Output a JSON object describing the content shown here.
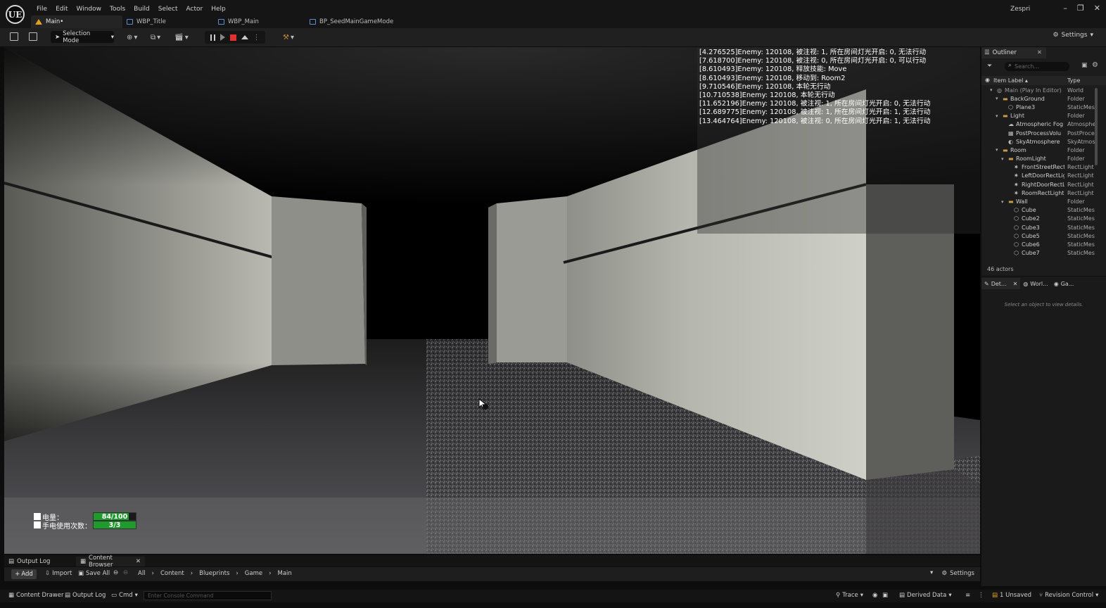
{
  "app": {
    "logo": "UE",
    "user": "Zespri",
    "menu": [
      "File",
      "Edit",
      "Window",
      "Tools",
      "Build",
      "Select",
      "Actor",
      "Help"
    ],
    "tabs": [
      {
        "label": "Main•",
        "active": true,
        "icon": "level-icon"
      },
      {
        "label": "WBP_Title",
        "active": false,
        "icon": "widget-blueprint-icon"
      },
      {
        "label": "WBP_Main",
        "active": false,
        "icon": "widget-blueprint-icon"
      },
      {
        "label": "BP_SeedMainGameMode",
        "active": false,
        "icon": "blueprint-icon"
      }
    ],
    "window_controls": [
      "–",
      "❐",
      "✕"
    ]
  },
  "toolbar": {
    "selection_mode": "Selection Mode",
    "settings_label": "Settings"
  },
  "viewport": {
    "debug_log": [
      "[4.276525]Enemy: 120108, 被注视: 1, 所在房间灯光开启: 0, 无法行动",
      "[7.618700]Enemy: 120108, 被注视: 0, 所在房间灯光开启: 0, 可以行动",
      "[8.610493]Enemy: 120108, 释放技能: Move",
      "[8.610493]Enemy: 120108, 移动到: Room2",
      "[9.710546]Enemy: 120108, 本轮无行动",
      "[10.710538]Enemy: 120108, 本轮无行动",
      "[11.652196]Enemy: 120108, 被注视: 1, 所在房间灯光开启: 0, 无法行动",
      "[12.689775]Enemy: 120108, 被注视: 1, 所在房间灯光开启: 1, 无法行动",
      "[13.464764]Enemy: 120108, 被注视: 0, 所在房间灯光开启: 1, 无法行动"
    ],
    "hud": {
      "battery_label": "电量：",
      "battery_text": "84/100",
      "battery_fraction": 0.84,
      "flashlight_label": "手电使用次数：",
      "flashlight_text": "3/3",
      "flashlight_fraction": 1.0,
      "bar_color": "#1f9a2c"
    }
  },
  "outliner": {
    "title": "Outliner",
    "search_placeholder": "Search...",
    "col_label": "Item Label ▴",
    "col_type": "Type",
    "rows": [
      {
        "label": "Main (Play In Editor)",
        "type": "World",
        "depth": 0,
        "icon": "world-icon"
      },
      {
        "label": "BackGround",
        "type": "Folder",
        "depth": 1,
        "icon": "folder-icon"
      },
      {
        "label": "Plane3",
        "type": "StaticMes",
        "depth": 2,
        "icon": "mesh-icon"
      },
      {
        "label": "Light",
        "type": "Folder",
        "depth": 1,
        "icon": "folder-icon"
      },
      {
        "label": "Atmospheric Fog",
        "type": "Atmosphe",
        "depth": 2,
        "icon": "fog-icon"
      },
      {
        "label": "PostProcessVolu",
        "type": "PostProce",
        "depth": 2,
        "icon": "volume-icon"
      },
      {
        "label": "SkyAtmosphere",
        "type": "SkyAtmos",
        "depth": 2,
        "icon": "sky-icon"
      },
      {
        "label": "Room",
        "type": "Folder",
        "depth": 1,
        "icon": "folder-icon"
      },
      {
        "label": "RoomLight",
        "type": "Folder",
        "depth": 2,
        "icon": "folder-icon"
      },
      {
        "label": "FrontStreetRect",
        "type": "RectLight",
        "depth": 3,
        "icon": "light-icon"
      },
      {
        "label": "LeftDoorRectLig",
        "type": "RectLight",
        "depth": 3,
        "icon": "light-icon"
      },
      {
        "label": "RightDoorRectL",
        "type": "RectLight",
        "depth": 3,
        "icon": "light-icon"
      },
      {
        "label": "RoomRectLight",
        "type": "RectLight",
        "depth": 3,
        "icon": "light-icon"
      },
      {
        "label": "Wall",
        "type": "Folder",
        "depth": 2,
        "icon": "folder-icon"
      },
      {
        "label": "Cube",
        "type": "StaticMes",
        "depth": 3,
        "icon": "mesh-icon"
      },
      {
        "label": "Cube2",
        "type": "StaticMes",
        "depth": 3,
        "icon": "mesh-icon"
      },
      {
        "label": "Cube3",
        "type": "StaticMes",
        "depth": 3,
        "icon": "mesh-icon"
      },
      {
        "label": "Cube5",
        "type": "StaticMes",
        "depth": 3,
        "icon": "mesh-icon"
      },
      {
        "label": "Cube6",
        "type": "StaticMes",
        "depth": 3,
        "icon": "mesh-icon"
      },
      {
        "label": "Cube7",
        "type": "StaticMes",
        "depth": 3,
        "icon": "mesh-icon"
      }
    ],
    "actor_count": "46 actors"
  },
  "details": {
    "tabs": [
      "Det...",
      "Worl...",
      "Ga..."
    ],
    "empty_text": "Select an object to view details."
  },
  "bottom": {
    "tabs": [
      "Output Log",
      "Content Browser"
    ],
    "add": "Add",
    "import": "Import",
    "save_all": "Save All",
    "breadcrumb": [
      "All",
      "Content",
      "Blueprints",
      "Game",
      "Main"
    ],
    "settings": "Settings"
  },
  "status": {
    "content_drawer": "Content Drawer",
    "output_log": "Output Log",
    "cmd": "Cmd",
    "console_placeholder": "Enter Console Command",
    "trace": "Trace",
    "derived_data": "Derived Data",
    "unsaved": "1 Unsaved",
    "revision_control": "Revision Control"
  }
}
